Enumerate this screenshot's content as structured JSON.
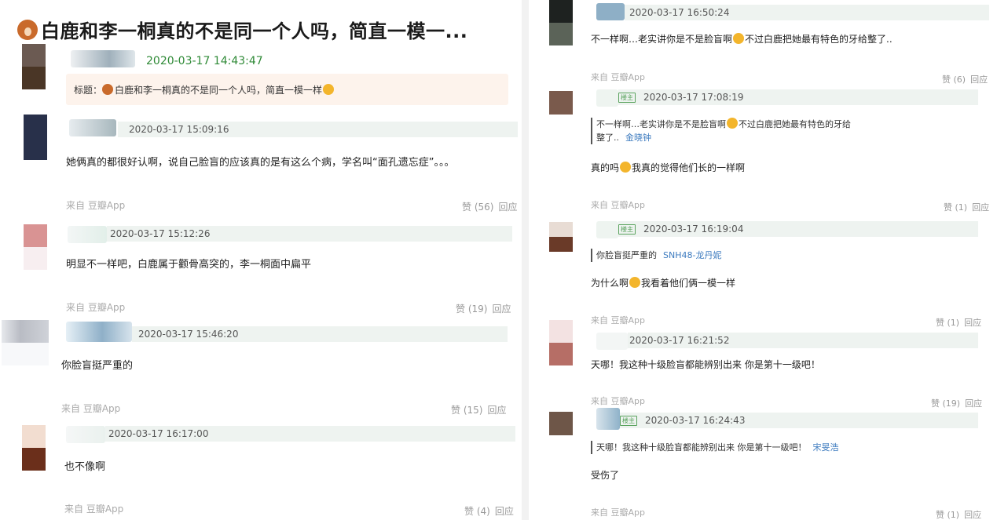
{
  "left": {
    "title": "白鹿和李一桐真的不是同一个人吗，简直一模一...",
    "op": {
      "time": "2020-03-17 14:43:47",
      "quote_label": "标题：",
      "quote_text": "白鹿和李一桐真的不是同一个人吗，简直一模一样"
    },
    "comments": [
      {
        "time": "2020-03-17 15:09:16",
        "text": "她俩真的都很好认啊，说自己脸盲的应该真的是有这么个病，学名叫“面孔遗忘症”。。。",
        "from": "来自 豆瓣App",
        "likes": "赞 (56)",
        "reply": "回应"
      },
      {
        "time": "2020-03-17 15:12:26",
        "text": "明显不一样吧，白鹿属于颧骨高突的，李一桐面中扁平",
        "from": "来自 豆瓣App",
        "likes": "赞 (19)",
        "reply": "回应"
      },
      {
        "time": "2020-03-17 15:46:20",
        "text": "你脸盲挺严重的",
        "from": "来自 豆瓣App",
        "likes": "赞 (15)",
        "reply": "回应"
      },
      {
        "time": "2020-03-17 16:17:00",
        "text": "也不像啊",
        "from": "来自 豆瓣App",
        "likes": "赞 (4)",
        "reply": "回应"
      }
    ]
  },
  "right": {
    "comments": [
      {
        "time": "2020-03-17 16:50:24",
        "text_a": "不一样啊…老实讲你是不是脸盲啊",
        "text_b": "不过白鹿把她最有特色的牙给整了..",
        "from": "来自 豆瓣App",
        "likes": "赞 (6)",
        "reply": "回应"
      },
      {
        "badge": "楼主",
        "time": "2020-03-17 17:08:19",
        "quote_line1_a": "不一样啊…老实讲你是不是脸盲啊",
        "quote_line1_b": "不过白鹿把她最有特色的牙给",
        "quote_line2": "整了..",
        "quote_author": "金晓钟",
        "text_a": "真的吗",
        "text_b": "我真的觉得他们长的一样啊",
        "from": "来自 豆瓣App",
        "likes": "赞 (1)",
        "reply": "回应"
      },
      {
        "badge": "楼主",
        "time": "2020-03-17 16:19:04",
        "quote": "你脸盲挺严重的",
        "quote_author": "SNH48-龙丹妮",
        "text_a": "为什么啊",
        "text_b": "我看着他们俩一模一样",
        "from": "来自 豆瓣App",
        "likes": "赞 (1)",
        "reply": "回应"
      },
      {
        "time": "2020-03-17 16:21:52",
        "text": "天哪！我这种十级脸盲都能辨别出来 你是第十一级吧！",
        "from": "来自 豆瓣App",
        "likes": "赞 (19)",
        "reply": "回应"
      },
      {
        "badge": "楼主",
        "time": "2020-03-17 16:24:43",
        "quote": "天哪！我这种十级脸盲都能辨别出来 你是第十一级吧！",
        "quote_author": "宋旻浩",
        "text": "受伤了",
        "from": "来自 豆瓣App",
        "likes": "赞 (1)",
        "reply": "回应"
      }
    ]
  }
}
